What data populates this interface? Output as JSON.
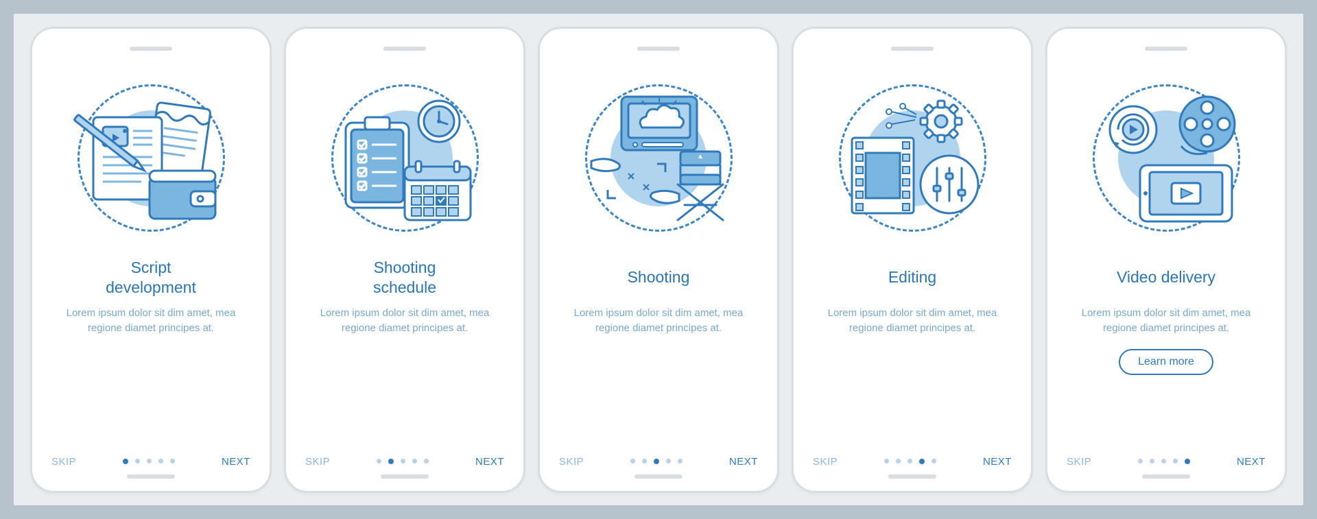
{
  "nav": {
    "skip": "SKIP",
    "next": "NEXT"
  },
  "cta_label": "Learn more",
  "colors": {
    "stroke": "#2e7abd",
    "fill_light": "#b0d4ee",
    "fill_mid": "#7bb6e0",
    "bg_disc": "#b0d4ee"
  },
  "screens": [
    {
      "id": "script-development",
      "title": "Script\ndevelopment",
      "desc": "Lorem ipsum dolor sit dim amet, mea regione diamet principes at.",
      "active_index": 0,
      "icon": "script-development-icon",
      "has_cta": false
    },
    {
      "id": "shooting-schedule",
      "title": "Shooting\nschedule",
      "desc": "Lorem ipsum dolor sit dim amet, mea regione diamet principes at.",
      "active_index": 1,
      "icon": "shooting-schedule-icon",
      "has_cta": false
    },
    {
      "id": "shooting",
      "title": "Shooting",
      "desc": "Lorem ipsum dolor sit dim amet, mea regione diamet principes at.",
      "active_index": 2,
      "icon": "shooting-icon",
      "has_cta": false
    },
    {
      "id": "editing",
      "title": "Editing",
      "desc": "Lorem ipsum dolor sit dim amet, mea regione diamet principes at.",
      "active_index": 3,
      "icon": "editing-icon",
      "has_cta": false
    },
    {
      "id": "video-delivery",
      "title": "Video delivery",
      "desc": "Lorem ipsum dolor sit dim amet, mea regione diamet principes at.",
      "active_index": 4,
      "icon": "video-delivery-icon",
      "has_cta": true
    }
  ]
}
